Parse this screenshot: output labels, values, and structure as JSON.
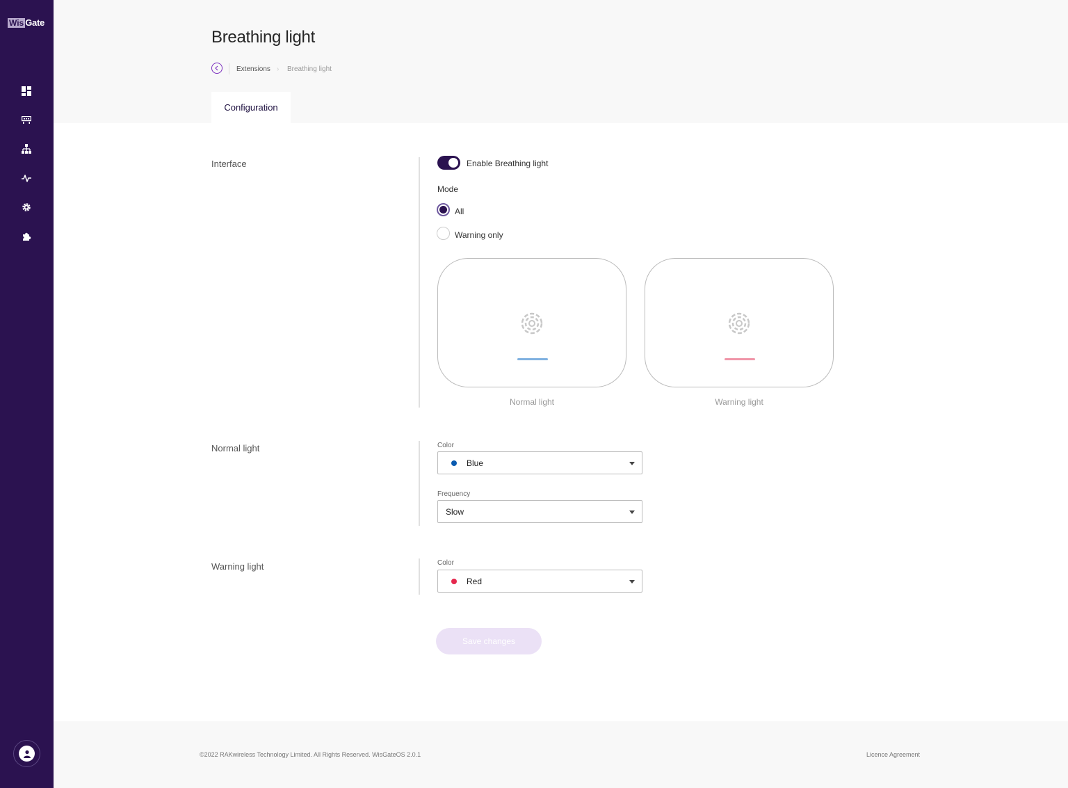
{
  "brand": {
    "logo_part1": "Wis",
    "logo_part2": "Gate"
  },
  "nav": {
    "items": [
      {
        "name": "dashboard-icon"
      },
      {
        "name": "gateway-icon"
      },
      {
        "name": "network-icon"
      },
      {
        "name": "activity-icon"
      },
      {
        "name": "settings-gear-icon"
      },
      {
        "name": "extensions-puzzle-icon"
      }
    ]
  },
  "page": {
    "title": "Breathing light"
  },
  "breadcrumb": {
    "parent": "Extensions",
    "current": "Breathing light"
  },
  "tabs": [
    {
      "label": "Configuration"
    }
  ],
  "interface": {
    "section_label": "Interface",
    "toggle_label": "Enable Breathing light",
    "toggle_on": true,
    "mode_label": "Mode",
    "modes": [
      {
        "label": "All",
        "checked": true
      },
      {
        "label": "Warning only",
        "checked": false
      }
    ],
    "previews": [
      {
        "caption": "Normal light",
        "bar_color": "#7fb1e0"
      },
      {
        "caption": "Warning light",
        "bar_color": "#f095a8"
      }
    ]
  },
  "normal_light": {
    "section_label": "Normal light",
    "color_label": "Color",
    "color_value": "Blue",
    "color_hex": "#0a5bb0",
    "frequency_label": "Frequency",
    "frequency_value": "Slow"
  },
  "warning_light": {
    "section_label": "Warning light",
    "color_label": "Color",
    "color_value": "Red",
    "color_hex": "#e5284d"
  },
  "actions": {
    "save_label": "Save changes"
  },
  "footer": {
    "copyright": "©2022 RAKwireless Technology Limited. All Rights Reserved. WisGateOS 2.0.1",
    "licence": "Licence Agreement"
  },
  "colors": {
    "sidebar": "#2b1250",
    "accent": "#7b2fbf"
  }
}
